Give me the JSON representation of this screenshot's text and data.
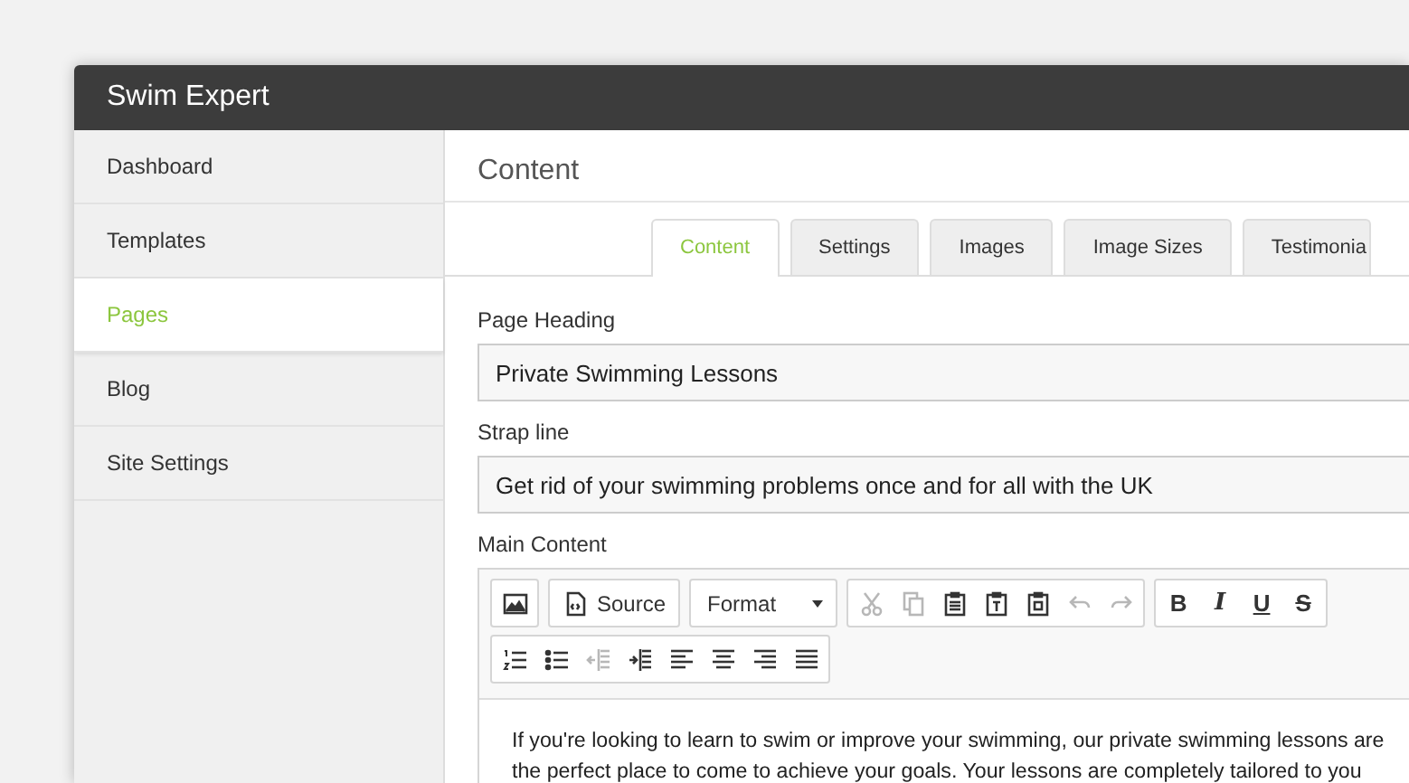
{
  "window": {
    "title": "Swim Expert"
  },
  "sidebar": {
    "items": [
      {
        "label": "Dashboard",
        "selected": false
      },
      {
        "label": "Templates",
        "selected": false
      },
      {
        "label": "Pages",
        "selected": true
      },
      {
        "label": "Blog",
        "selected": false
      },
      {
        "label": "Site Settings",
        "selected": false
      }
    ]
  },
  "main": {
    "heading": "Content",
    "tabs": [
      {
        "label": "Content",
        "selected": true
      },
      {
        "label": "Settings",
        "selected": false
      },
      {
        "label": "Images",
        "selected": false
      },
      {
        "label": "Image Sizes",
        "selected": false
      },
      {
        "label": "Testimonia",
        "selected": false
      }
    ],
    "fields": [
      {
        "label": "Page Heading",
        "value": "Private Swimming Lessons"
      },
      {
        "label": "Strap line",
        "value": "Get rid of your swimming problems once and for all with the UK"
      }
    ],
    "editor": {
      "label": "Main Content",
      "toolbar": [
        [
          [
            {
              "kind": "image",
              "disabled": false
            }
          ],
          [
            {
              "kind": "source",
              "label": "Source",
              "disabled": false
            }
          ],
          [
            {
              "kind": "dropdown",
              "label": "Format",
              "disabled": false
            }
          ],
          [
            {
              "kind": "cut",
              "disabled": true
            },
            {
              "kind": "copy",
              "disabled": true
            },
            {
              "kind": "paste",
              "disabled": false
            },
            {
              "kind": "paste-text",
              "disabled": false
            },
            {
              "kind": "paste-word",
              "disabled": false
            },
            {
              "kind": "undo",
              "disabled": true
            },
            {
              "kind": "redo",
              "disabled": true
            }
          ],
          [
            {
              "kind": "bold",
              "label": "B",
              "disabled": false
            },
            {
              "kind": "italic",
              "label": "I",
              "disabled": false
            },
            {
              "kind": "underline",
              "label": "U",
              "disabled": false
            },
            {
              "kind": "strike",
              "label": "S",
              "disabled": false
            }
          ]
        ],
        [
          [
            {
              "kind": "numbered-list",
              "disabled": false
            },
            {
              "kind": "bullet-list",
              "disabled": false
            },
            {
              "kind": "outdent",
              "disabled": true
            },
            {
              "kind": "indent",
              "disabled": false
            },
            {
              "kind": "align-left",
              "disabled": false
            },
            {
              "kind": "align-center",
              "disabled": false
            },
            {
              "kind": "align-right",
              "disabled": false
            },
            {
              "kind": "justify",
              "disabled": false
            }
          ]
        ]
      ],
      "body": "If you're looking to learn to swim or improve your swimming, our private swimming lessons are the perfect place to come to achieve your goals. Your lessons are completely tailored to you"
    }
  }
}
